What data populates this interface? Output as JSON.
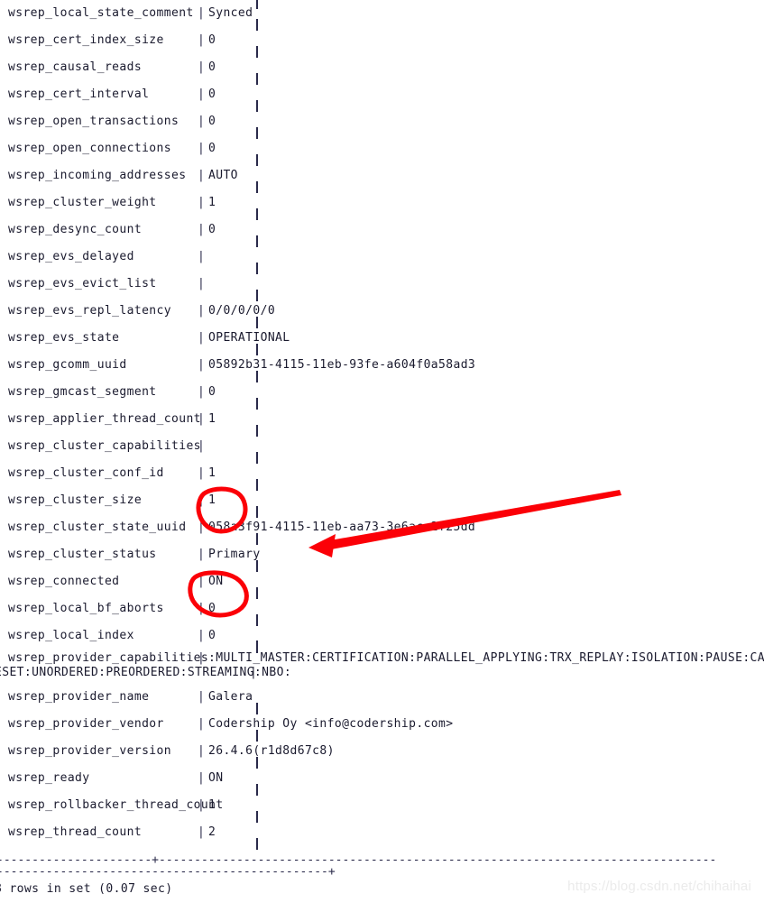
{
  "terminal": {
    "rows": [
      {
        "name": "wsrep_local_state_comment",
        "value": "Synced"
      },
      {
        "name": "wsrep_cert_index_size",
        "value": "0"
      },
      {
        "name": "wsrep_causal_reads",
        "value": "0"
      },
      {
        "name": "wsrep_cert_interval",
        "value": "0"
      },
      {
        "name": "wsrep_open_transactions",
        "value": "0"
      },
      {
        "name": "wsrep_open_connections",
        "value": "0"
      },
      {
        "name": "wsrep_incoming_addresses",
        "value": "AUTO"
      },
      {
        "name": "wsrep_cluster_weight",
        "value": "1"
      },
      {
        "name": "wsrep_desync_count",
        "value": "0"
      },
      {
        "name": "wsrep_evs_delayed",
        "value": ""
      },
      {
        "name": "wsrep_evs_evict_list",
        "value": ""
      },
      {
        "name": "wsrep_evs_repl_latency",
        "value": "0/0/0/0/0"
      },
      {
        "name": "wsrep_evs_state",
        "value": "OPERATIONAL"
      },
      {
        "name": "wsrep_gcomm_uuid",
        "value": "05892b31-4115-11eb-93fe-a604f0a58ad3"
      },
      {
        "name": "wsrep_gmcast_segment",
        "value": "0"
      },
      {
        "name": "wsrep_applier_thread_count",
        "value": "1"
      },
      {
        "name": "wsrep_cluster_capabilities",
        "value": ""
      },
      {
        "name": "wsrep_cluster_conf_id",
        "value": "1"
      },
      {
        "name": "wsrep_cluster_size",
        "value": "1"
      },
      {
        "name": "wsrep_cluster_state_uuid",
        "value": "058a3f91-4115-11eb-aa73-3e6ace2f25dd"
      },
      {
        "name": "wsrep_cluster_status",
        "value": "Primary"
      },
      {
        "name": "wsrep_connected",
        "value": "ON"
      },
      {
        "name": "wsrep_local_bf_aborts",
        "value": "0"
      },
      {
        "name": "wsrep_local_index",
        "value": "0"
      }
    ],
    "wrapped_row": {
      "name": "wsrep_provider_capabilities",
      "value": ":MULTI_MASTER:CERTIFICATION:PARALLEL_APPLYING:TRX_REPLAY:ISOLATION:PAUSE:CAUSAL_READS:IN",
      "continuation": "ESET:UNORDERED:PREORDERED:STREAMING:NBO: ",
      "continuation_pipe": "|"
    },
    "rows_tail": [
      {
        "name": "wsrep_provider_name",
        "value": "Galera"
      },
      {
        "name": "wsrep_provider_vendor",
        "value": "Codership Oy <info@codership.com>"
      },
      {
        "name": "wsrep_provider_version",
        "value": "26.4.6(r1d8d67c8)"
      },
      {
        "name": "wsrep_ready",
        "value": "ON"
      },
      {
        "name": "wsrep_rollbacker_thread_count",
        "value": "1"
      },
      {
        "name": "wsrep_thread_count",
        "value": "2"
      }
    ],
    "separator_long": "----------------------+-------------------------------------------------------------------------------",
    "separator_short": "-----------------------------------------------+",
    "footer": "8 rows in set (0.07 sec)"
  },
  "annotations": {
    "circle_cluster_size_target": "wsrep_cluster_size value 1",
    "circle_connected_target": "wsrep_connected value ON",
    "arrow_target": "wsrep_cluster_state_uuid row",
    "color": "#fb0007"
  },
  "watermark": {
    "text": "https://blog.csdn.net/chihaihai"
  }
}
